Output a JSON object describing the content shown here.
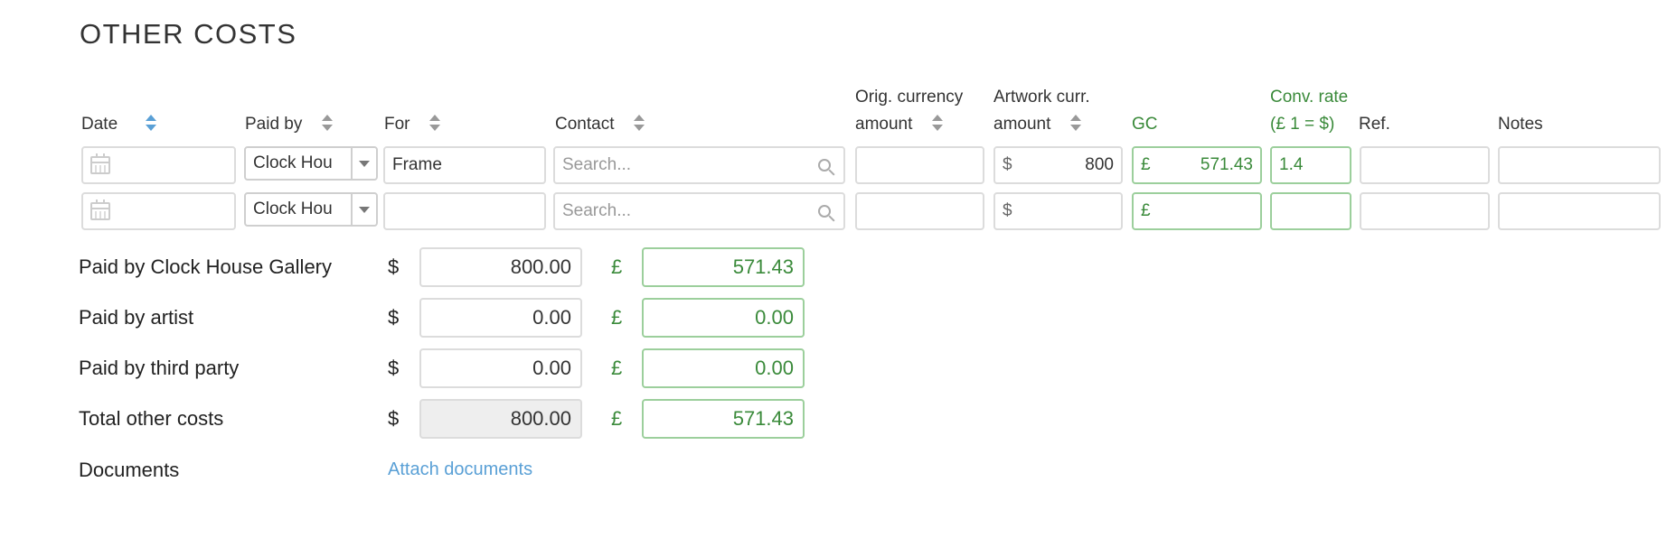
{
  "section": {
    "title": "OTHER COSTS"
  },
  "table": {
    "headers": {
      "date": "Date",
      "paid_by": "Paid by",
      "for": "For",
      "contact": "Contact",
      "orig_currency_line1": "Orig. currency",
      "orig_currency_line2": "amount",
      "artwork_curr_line1": "Artwork curr.",
      "artwork_curr_line2": "amount",
      "gc": "GC",
      "conv_rate_line1": "Conv. rate",
      "conv_rate_line2": "(£ 1 = $)",
      "ref": "Ref.",
      "notes": "Notes"
    },
    "rows": [
      {
        "date": "",
        "paid_by": "Clock Hou",
        "for": "Frame",
        "contact_placeholder": "Search...",
        "orig_amount": "",
        "artwork_currency_symbol": "$",
        "artwork_amount": "800",
        "gc_currency_symbol": "£",
        "gc_amount": "571.43",
        "conv_rate": "1.4",
        "ref": "",
        "notes": ""
      },
      {
        "date": "",
        "paid_by": "Clock Hou",
        "for": "",
        "contact_placeholder": "Search...",
        "orig_amount": "",
        "artwork_currency_symbol": "$",
        "artwork_amount": "",
        "gc_currency_symbol": "£",
        "gc_amount": "",
        "conv_rate": "",
        "ref": "",
        "notes": ""
      }
    ]
  },
  "summary": {
    "usd_symbol": "$",
    "gbp_symbol": "£",
    "rows": [
      {
        "label": "Paid by Clock House Gallery",
        "usd": "800.00",
        "gbp": "571.43"
      },
      {
        "label": "Paid by artist",
        "usd": "0.00",
        "gbp": "0.00"
      },
      {
        "label": "Paid by third party",
        "usd": "0.00",
        "gbp": "0.00"
      },
      {
        "label": "Total other costs",
        "usd": "800.00",
        "gbp": "571.43"
      }
    ],
    "documents_label": "Documents",
    "attach_link": "Attach documents"
  },
  "colors": {
    "green": "#3a8a3a",
    "link": "#5aa0d6"
  }
}
